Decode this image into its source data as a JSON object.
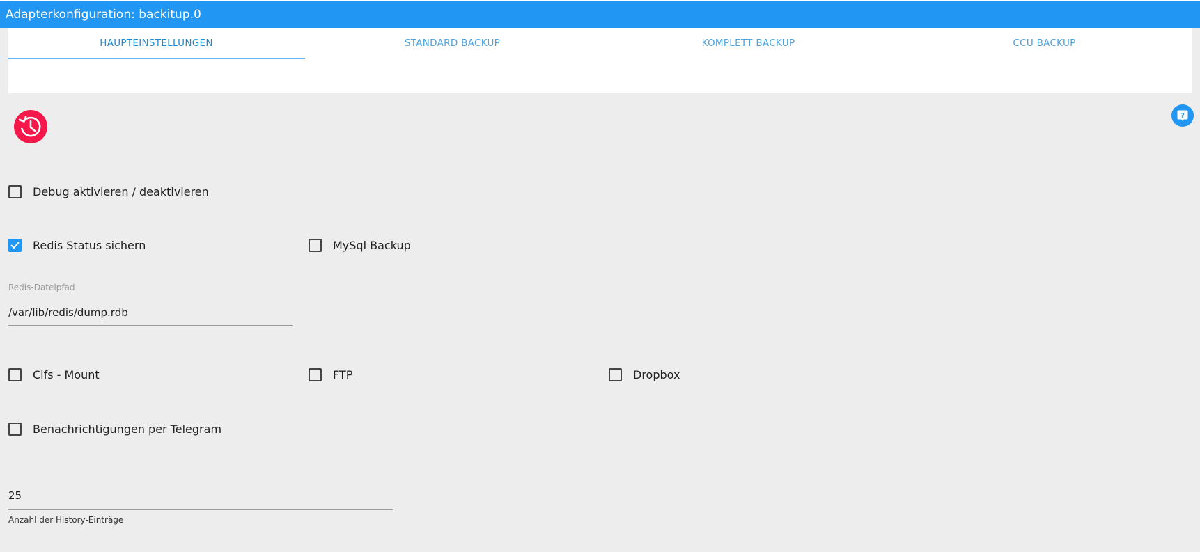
{
  "window": {
    "title": "Adapterkonfiguration: backitup.0"
  },
  "tabs": [
    {
      "label": "HAUPTEINSTELLUNGEN",
      "active": true
    },
    {
      "label": "STANDARD BACKUP",
      "active": false
    },
    {
      "label": "KOMPLETT BACKUP",
      "active": false
    },
    {
      "label": "CCU BACKUP",
      "active": false
    }
  ],
  "icons": {
    "logo": "history-clock-icon",
    "help": "help-question-icon",
    "check": "checkmark-icon"
  },
  "colors": {
    "accent": "#2196f3",
    "logo": "#f6184a",
    "background": "#ededed"
  },
  "settings": {
    "debug": {
      "label": "Debug aktivieren / deaktivieren",
      "checked": false
    },
    "redis": {
      "label": "Redis Status sichern",
      "checked": true
    },
    "mysql": {
      "label": "MySql Backup",
      "checked": false
    },
    "redis_path": {
      "label": "Redis-Dateipfad",
      "value": "/var/lib/redis/dump.rdb"
    },
    "cifs": {
      "label": "Cifs - Mount",
      "checked": false
    },
    "ftp": {
      "label": "FTP",
      "checked": false
    },
    "dropbox": {
      "label": "Dropbox",
      "checked": false
    },
    "telegram": {
      "label": "Benachrichtigungen per Telegram",
      "checked": false
    },
    "history": {
      "value": "25",
      "helper": "Anzahl der History-Einträge"
    }
  }
}
